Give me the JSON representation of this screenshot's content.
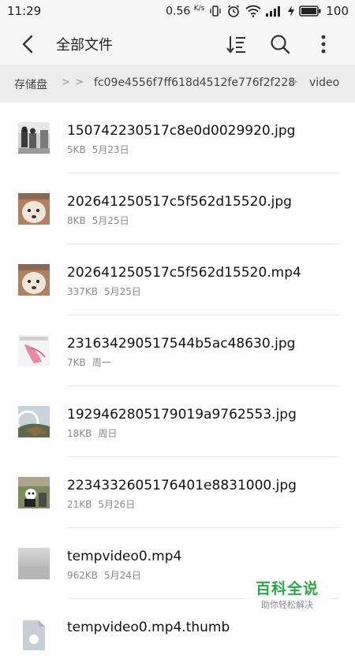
{
  "status_bar": {
    "time": "11:29",
    "net_speed": "0.56",
    "net_unit": "K/s",
    "battery": "100"
  },
  "header": {
    "title": "全部文件",
    "icons": [
      "back-arrow-icon",
      "sort-icon",
      "search-icon",
      "more-vertical-icon"
    ]
  },
  "breadcrumb": {
    "items": [
      "存储盘",
      "fc09e4556f7ff618d4512fe776f2f228",
      "video"
    ]
  },
  "files": [
    {
      "name": "150742230517c8e0d0029920.jpg",
      "size": "5KB",
      "date": "5月23日",
      "thumb": "photo-people"
    },
    {
      "name": "202641250517c5f562d15520.jpg",
      "size": "8KB",
      "date": "5月25日",
      "thumb": "photo-dog"
    },
    {
      "name": "202641250517c5f562d15520.mp4",
      "size": "337KB",
      "date": "5月25日",
      "thumb": "photo-dog"
    },
    {
      "name": "231634290517544b5ac48630.jpg",
      "size": "7KB",
      "date": "周一",
      "thumb": "photo-flower"
    },
    {
      "name": "1929462805179019a9762553.jpg",
      "size": "18KB",
      "date": "周日",
      "thumb": "photo-landscape"
    },
    {
      "name": "2234332605176401e8831000.jpg",
      "size": "21KB",
      "date": "5月26日",
      "thumb": "photo-outdoor"
    },
    {
      "name": "tempvideo0.mp4",
      "size": "962KB",
      "date": "5月24日",
      "thumb": "video-gray"
    },
    {
      "name": "tempvideo0.mp4.thumb",
      "size": "",
      "date": "",
      "thumb": "file-generic"
    }
  ],
  "watermark": {
    "line1": "百科全说",
    "line2": "助你轻松解决"
  },
  "colors": {
    "header_bg": "#f6f6f6",
    "breadcrumb_bg": "#ececec",
    "watermark_green": "#2aa84a"
  }
}
